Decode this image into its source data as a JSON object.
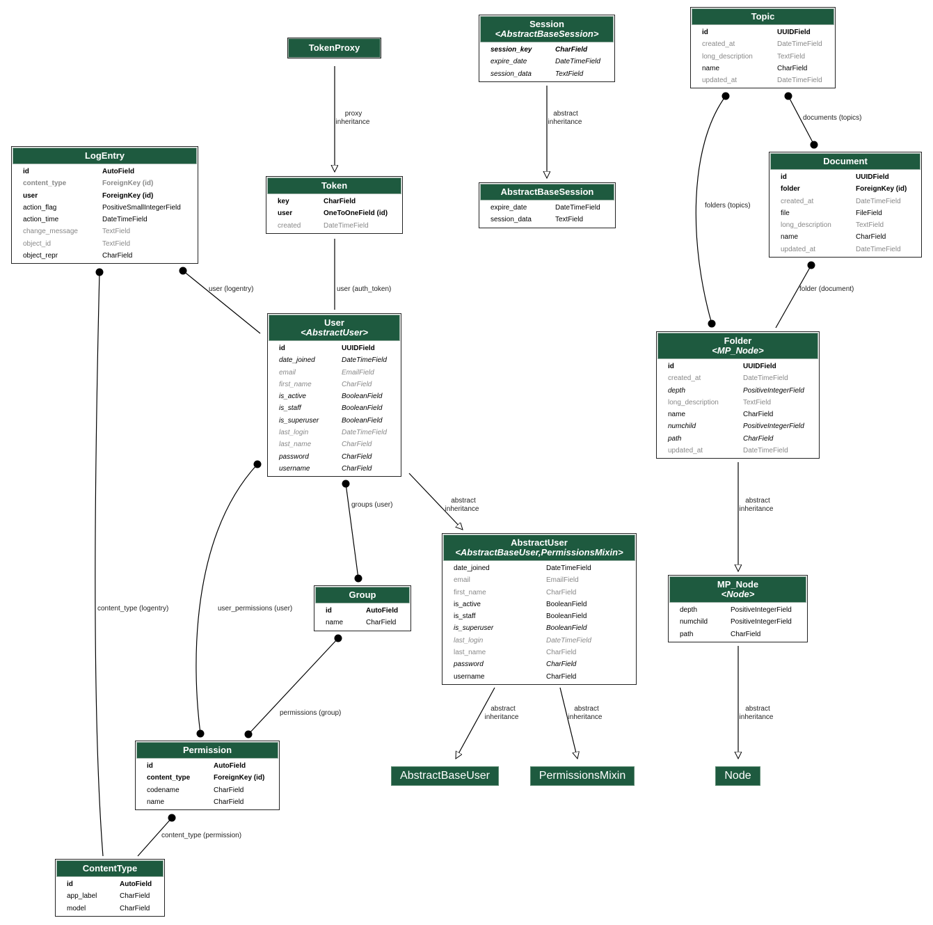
{
  "models": {
    "logentry": {
      "title": "LogEntry",
      "fields": [
        {
          "name": "id",
          "type": "AutoField",
          "style": "b"
        },
        {
          "name": "content_type",
          "type": "ForeignKey (id)",
          "style": "gb"
        },
        {
          "name": "user",
          "type": "ForeignKey (id)",
          "style": "b"
        },
        {
          "name": "action_flag",
          "type": "PositiveSmallIntegerField",
          "style": "n"
        },
        {
          "name": "action_time",
          "type": "DateTimeField",
          "style": "n"
        },
        {
          "name": "change_message",
          "type": "TextField",
          "style": "g"
        },
        {
          "name": "object_id",
          "type": "TextField",
          "style": "g"
        },
        {
          "name": "object_repr",
          "type": "CharField",
          "style": "n"
        }
      ]
    },
    "tokenproxy": {
      "title": "TokenProxy",
      "fields": []
    },
    "token": {
      "title": "Token",
      "fields": [
        {
          "name": "key",
          "type": "CharField",
          "style": "b"
        },
        {
          "name": "user",
          "type": "OneToOneField (id)",
          "style": "b"
        },
        {
          "name": "created",
          "type": "DateTimeField",
          "style": "g"
        }
      ]
    },
    "session": {
      "title": "Session",
      "subtitle": "<AbstractBaseSession>",
      "fields": [
        {
          "name": "session_key",
          "type": "CharField",
          "style": "bi"
        },
        {
          "name": "expire_date",
          "type": "DateTimeField",
          "style": "i"
        },
        {
          "name": "session_data",
          "type": "TextField",
          "style": "i"
        }
      ]
    },
    "abstractbasesession": {
      "title": "AbstractBaseSession",
      "fields": [
        {
          "name": "expire_date",
          "type": "DateTimeField",
          "style": "n"
        },
        {
          "name": "session_data",
          "type": "TextField",
          "style": "n"
        }
      ]
    },
    "topic": {
      "title": "Topic",
      "fields": [
        {
          "name": "id",
          "type": "UUIDField",
          "style": "b"
        },
        {
          "name": "created_at",
          "type": "DateTimeField",
          "style": "g"
        },
        {
          "name": "long_description",
          "type": "TextField",
          "style": "g"
        },
        {
          "name": "name",
          "type": "CharField",
          "style": "n"
        },
        {
          "name": "updated_at",
          "type": "DateTimeField",
          "style": "g"
        }
      ]
    },
    "document": {
      "title": "Document",
      "fields": [
        {
          "name": "id",
          "type": "UUIDField",
          "style": "b"
        },
        {
          "name": "folder",
          "type": "ForeignKey (id)",
          "style": "b"
        },
        {
          "name": "created_at",
          "type": "DateTimeField",
          "style": "g"
        },
        {
          "name": "file",
          "type": "FileField",
          "style": "n"
        },
        {
          "name": "long_description",
          "type": "TextField",
          "style": "g"
        },
        {
          "name": "name",
          "type": "CharField",
          "style": "n"
        },
        {
          "name": "updated_at",
          "type": "DateTimeField",
          "style": "g"
        }
      ]
    },
    "user": {
      "title": "User",
      "subtitle": "<AbstractUser>",
      "fields": [
        {
          "name": "id",
          "type": "UUIDField",
          "style": "b"
        },
        {
          "name": "date_joined",
          "type": "DateTimeField",
          "style": "i"
        },
        {
          "name": "email",
          "type": "EmailField",
          "style": "gi"
        },
        {
          "name": "first_name",
          "type": "CharField",
          "style": "gi"
        },
        {
          "name": "is_active",
          "type": "BooleanField",
          "style": "i"
        },
        {
          "name": "is_staff",
          "type": "BooleanField",
          "style": "i"
        },
        {
          "name": "is_superuser",
          "type": "BooleanField",
          "style": "i"
        },
        {
          "name": "last_login",
          "type": "DateTimeField",
          "style": "gi"
        },
        {
          "name": "last_name",
          "type": "CharField",
          "style": "gi"
        },
        {
          "name": "password",
          "type": "CharField",
          "style": "i"
        },
        {
          "name": "username",
          "type": "CharField",
          "style": "i"
        }
      ]
    },
    "folder": {
      "title": "Folder",
      "subtitle": "<MP_Node>",
      "fields": [
        {
          "name": "id",
          "type": "UUIDField",
          "style": "b"
        },
        {
          "name": "created_at",
          "type": "DateTimeField",
          "style": "g"
        },
        {
          "name": "depth",
          "type": "PositiveIntegerField",
          "style": "i"
        },
        {
          "name": "long_description",
          "type": "TextField",
          "style": "g"
        },
        {
          "name": "name",
          "type": "CharField",
          "style": "n"
        },
        {
          "name": "numchild",
          "type": "PositiveIntegerField",
          "style": "i"
        },
        {
          "name": "path",
          "type": "CharField",
          "style": "i"
        },
        {
          "name": "updated_at",
          "type": "DateTimeField",
          "style": "g"
        }
      ]
    },
    "abstractuser": {
      "title": "AbstractUser",
      "subtitle": "<AbstractBaseUser,PermissionsMixin>",
      "fields": [
        {
          "name": "date_joined",
          "type": "DateTimeField",
          "style": "n"
        },
        {
          "name": "email",
          "type": "EmailField",
          "style": "g"
        },
        {
          "name": "first_name",
          "type": "CharField",
          "style": "g"
        },
        {
          "name": "is_active",
          "type": "BooleanField",
          "style": "n"
        },
        {
          "name": "is_staff",
          "type": "BooleanField",
          "style": "n"
        },
        {
          "name": "is_superuser",
          "type": "BooleanField",
          "style": "i"
        },
        {
          "name": "last_login",
          "type": "DateTimeField",
          "style": "gi"
        },
        {
          "name": "last_name",
          "type": "CharField",
          "style": "g"
        },
        {
          "name": "password",
          "type": "CharField",
          "style": "i"
        },
        {
          "name": "username",
          "type": "CharField",
          "style": "n"
        }
      ]
    },
    "group": {
      "title": "Group",
      "fields": [
        {
          "name": "id",
          "type": "AutoField",
          "style": "b"
        },
        {
          "name": "name",
          "type": "CharField",
          "style": "n"
        }
      ]
    },
    "mp_node": {
      "title": "MP_Node",
      "subtitle": "<Node>",
      "fields": [
        {
          "name": "depth",
          "type": "PositiveIntegerField",
          "style": "n"
        },
        {
          "name": "numchild",
          "type": "PositiveIntegerField",
          "style": "n"
        },
        {
          "name": "path",
          "type": "CharField",
          "style": "n"
        }
      ]
    },
    "permission": {
      "title": "Permission",
      "fields": [
        {
          "name": "id",
          "type": "AutoField",
          "style": "b"
        },
        {
          "name": "content_type",
          "type": "ForeignKey (id)",
          "style": "b"
        },
        {
          "name": "codename",
          "type": "CharField",
          "style": "n"
        },
        {
          "name": "name",
          "type": "CharField",
          "style": "n"
        }
      ]
    },
    "contenttype": {
      "title": "ContentType",
      "fields": [
        {
          "name": "id",
          "type": "AutoField",
          "style": "b"
        },
        {
          "name": "app_label",
          "type": "CharField",
          "style": "n"
        },
        {
          "name": "model",
          "type": "CharField",
          "style": "n"
        }
      ]
    }
  },
  "plain_nodes": {
    "abstractbaseuser": "AbstractBaseUser",
    "permissionsmixin": "PermissionsMixin",
    "node": "Node"
  },
  "edges": {
    "tokenproxy_token": [
      "proxy",
      "inheritance"
    ],
    "session_abs": [
      "abstract",
      "inheritance"
    ],
    "documents_topics": "documents (topics)",
    "folders_topics": "folders (topics)",
    "folder_document": "folder (document)",
    "user_logentry": "user (logentry)",
    "user_auth_token": "user (auth_token)",
    "groups_user": "groups (user)",
    "user_abstractuser": [
      "abstract",
      "inheritance"
    ],
    "folder_mpnode": [
      "abstract",
      "inheritance"
    ],
    "content_type_logentry": "content_type (logentry)",
    "user_permissions_user": "user_permissions (user)",
    "permissions_group": "permissions (group)",
    "au_abu": [
      "abstract",
      "inheritance"
    ],
    "au_pm": [
      "abstract",
      "inheritance"
    ],
    "mpnode_node": [
      "abstract",
      "inheritance"
    ],
    "content_type_permission": "content_type (permission)"
  },
  "colors": {
    "header": "#1e5a3f",
    "edge": "#000000",
    "muted_text": "#888888"
  }
}
